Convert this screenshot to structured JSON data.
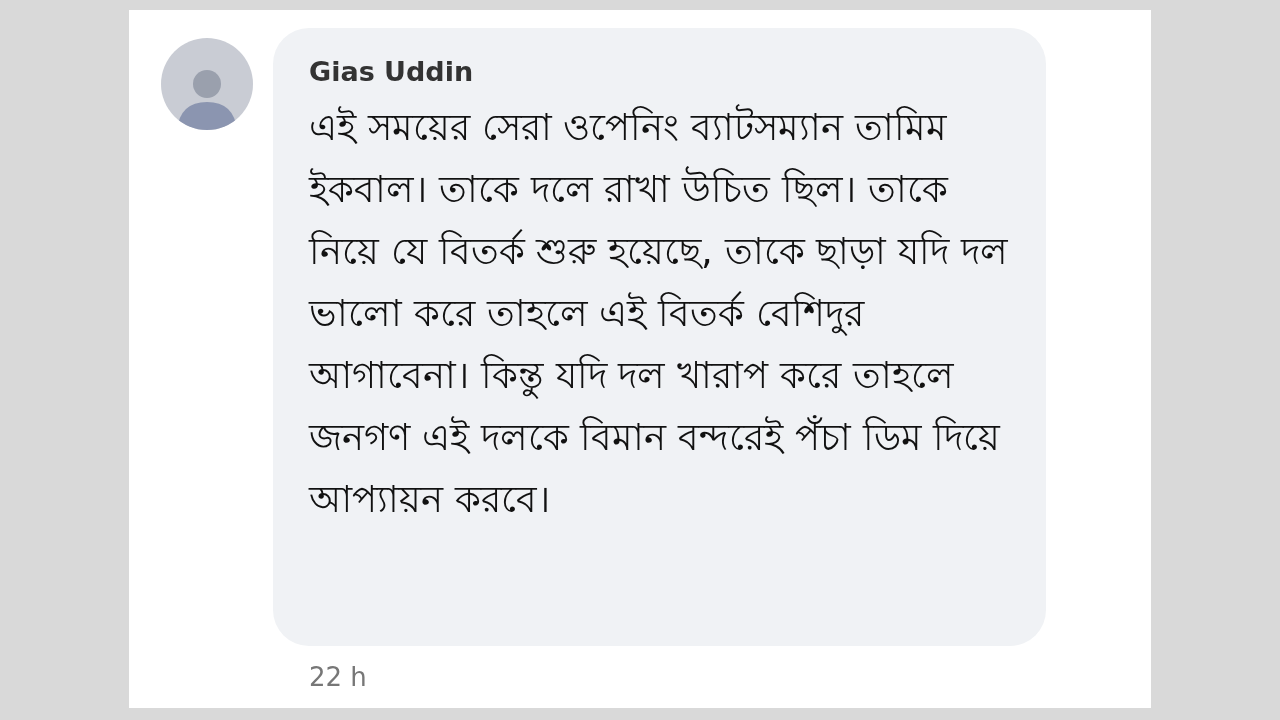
{
  "comment": {
    "author": "Gias Uddin",
    "text": "এই সময়ের সেরা ওপেনিং ব্যাটসম্যান তামিম ইকবাল। তাকে দলে রাখা উচিত ছিল। তাকে নিয়ে যে বিতর্ক শুরু হয়েছে, তাকে ছাড়া যদি দল ভালো করে তাহলে এই বিতর্ক বেশিদুর আগাবেনা। কিন্তু যদি দল খারাপ করে তাহলে জনগণ এই দলকে বিমান বন্দরেই পঁচা ডিম দিয়ে আপ্যায়ন করবে।",
    "time": "22 h"
  }
}
